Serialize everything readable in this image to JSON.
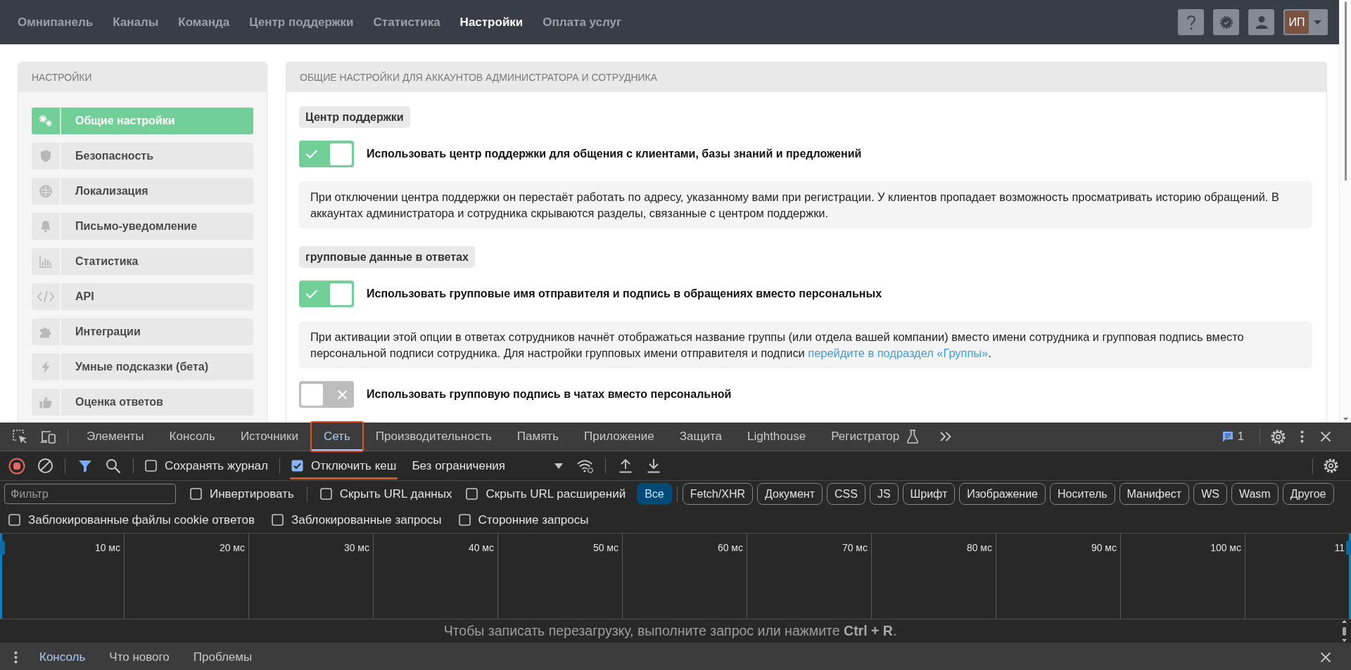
{
  "top_nav": {
    "items": [
      {
        "label": "Омнипанель",
        "selected": false
      },
      {
        "label": "Каналы",
        "selected": false
      },
      {
        "label": "Команда",
        "selected": false
      },
      {
        "label": "Центр поддержки",
        "selected": false
      },
      {
        "label": "Статистика",
        "selected": false
      },
      {
        "label": "Настройки",
        "selected": true
      },
      {
        "label": "Оплата услуг",
        "selected": false
      }
    ],
    "avatar_initials": "ИП"
  },
  "sidebar": {
    "title": "НАСТРОЙКИ",
    "items": [
      {
        "label": "Общие настройки",
        "selected": true
      },
      {
        "label": "Безопасность",
        "selected": false
      },
      {
        "label": "Локализация",
        "selected": false
      },
      {
        "label": "Письмо-уведомление",
        "selected": false
      },
      {
        "label": "Статистика",
        "selected": false
      },
      {
        "label": "API",
        "selected": false
      },
      {
        "label": "Интеграции",
        "selected": false
      },
      {
        "label": "Умные подсказки (бета)",
        "selected": false
      },
      {
        "label": "Оценка ответов",
        "selected": false
      }
    ]
  },
  "settings": {
    "title": "ОБЩИЕ НАСТРОЙКИ ДЛЯ АККАУНТОВ АДМИНИСТРАТОРА И СОТРУДНИКА",
    "blocks": [
      {
        "kind": "heading",
        "text": "Центр поддержки"
      },
      {
        "kind": "toggle",
        "label": "Использовать центр поддержки для общения с клиентами, базы знаний и предложений",
        "on": true
      },
      {
        "kind": "note",
        "text": "При отключении центра поддержки он перестаёт работать по адресу, указанному вами при регистрации. У клиентов пропадает возможность просматривать историю обращений. В аккаунтах администратора и сотрудника скрываются разделы, связанные с центром поддержки."
      },
      {
        "kind": "heading",
        "text": "групповые данные в ответах"
      },
      {
        "kind": "toggle",
        "label": "Использовать групповые имя отправителя и подпись в обращениях вместо персональных",
        "on": true
      },
      {
        "kind": "note",
        "text": "При активации этой опции в ответах сотрудников начнёт отображаться название группы (или отдела вашей компании) вместо имени сотрудника и групповая подпись вместо персональной подписи сотрудника. Для настройки групповых имени отправителя и подписи",
        "link": "перейдите в подраздел «Группы»",
        "after": "."
      },
      {
        "kind": "toggle",
        "label": "Использовать групповую подпись в чатах вместо персональной",
        "on": false
      }
    ]
  },
  "devtools": {
    "tabs": [
      {
        "label": "Элементы",
        "selected": false,
        "annotated": false,
        "experimental": false
      },
      {
        "label": "Консоль",
        "selected": false,
        "annotated": false,
        "experimental": false
      },
      {
        "label": "Источники",
        "selected": false,
        "annotated": false,
        "experimental": false
      },
      {
        "label": "Сеть",
        "selected": true,
        "annotated": true,
        "experimental": false
      },
      {
        "label": "Производительность",
        "selected": false,
        "annotated": false,
        "experimental": false
      },
      {
        "label": "Память",
        "selected": false,
        "annotated": false,
        "experimental": false
      },
      {
        "label": "Приложение",
        "selected": false,
        "annotated": false,
        "experimental": false
      },
      {
        "label": "Защита",
        "selected": false,
        "annotated": false,
        "experimental": false
      },
      {
        "label": "Lighthouse",
        "selected": false,
        "annotated": false,
        "experimental": false
      },
      {
        "label": "Регистратор",
        "selected": false,
        "annotated": false,
        "experimental": true
      }
    ],
    "issues_count": "1",
    "recording": true,
    "toolbar_options": [
      {
        "label": "Сохранять журнал",
        "checked": false,
        "annotated": false
      },
      {
        "label": "Отключить кеш",
        "checked": true,
        "annotated": true
      }
    ],
    "throttling": "Без ограничения",
    "filter": {
      "placeholder": "Фильтр"
    },
    "filter_options": [
      {
        "label": "Инвертировать",
        "checked": false
      },
      {
        "label": "Скрыть URL данных",
        "checked": false
      },
      {
        "label": "Скрыть URL расширений",
        "checked": false
      }
    ],
    "type_filters": [
      {
        "label": "Все",
        "selected": true
      },
      {
        "label": "Fetch/XHR",
        "selected": false
      },
      {
        "label": "Документ",
        "selected": false
      },
      {
        "label": "CSS",
        "selected": false
      },
      {
        "label": "JS",
        "selected": false
      },
      {
        "label": "Шрифт",
        "selected": false
      },
      {
        "label": "Изображение",
        "selected": false
      },
      {
        "label": "Носитель",
        "selected": false
      },
      {
        "label": "Манифест",
        "selected": false
      },
      {
        "label": "WS",
        "selected": false
      },
      {
        "label": "Wasm",
        "selected": false
      },
      {
        "label": "Другое",
        "selected": false
      }
    ],
    "request_options": [
      {
        "label": "Заблокированные файлы cookie ответов",
        "checked": false
      },
      {
        "label": "Заблокированные запросы",
        "checked": false
      },
      {
        "label": "Сторонние запросы",
        "checked": false
      }
    ],
    "timeline_ticks": [
      "10 мс",
      "20 мс",
      "30 мс",
      "40 мс",
      "50 мс",
      "60 мс",
      "70 мс",
      "80 мс",
      "90 мс",
      "100 мс",
      "11"
    ],
    "hint": "Чтобы записать перезагрузку, выполните запрос или нажмите **Ctrl + R**.",
    "drawer_tabs": [
      {
        "label": "Консоль",
        "selected": true
      },
      {
        "label": "Что нового",
        "selected": false
      },
      {
        "label": "Проблемы",
        "selected": false
      }
    ]
  }
}
